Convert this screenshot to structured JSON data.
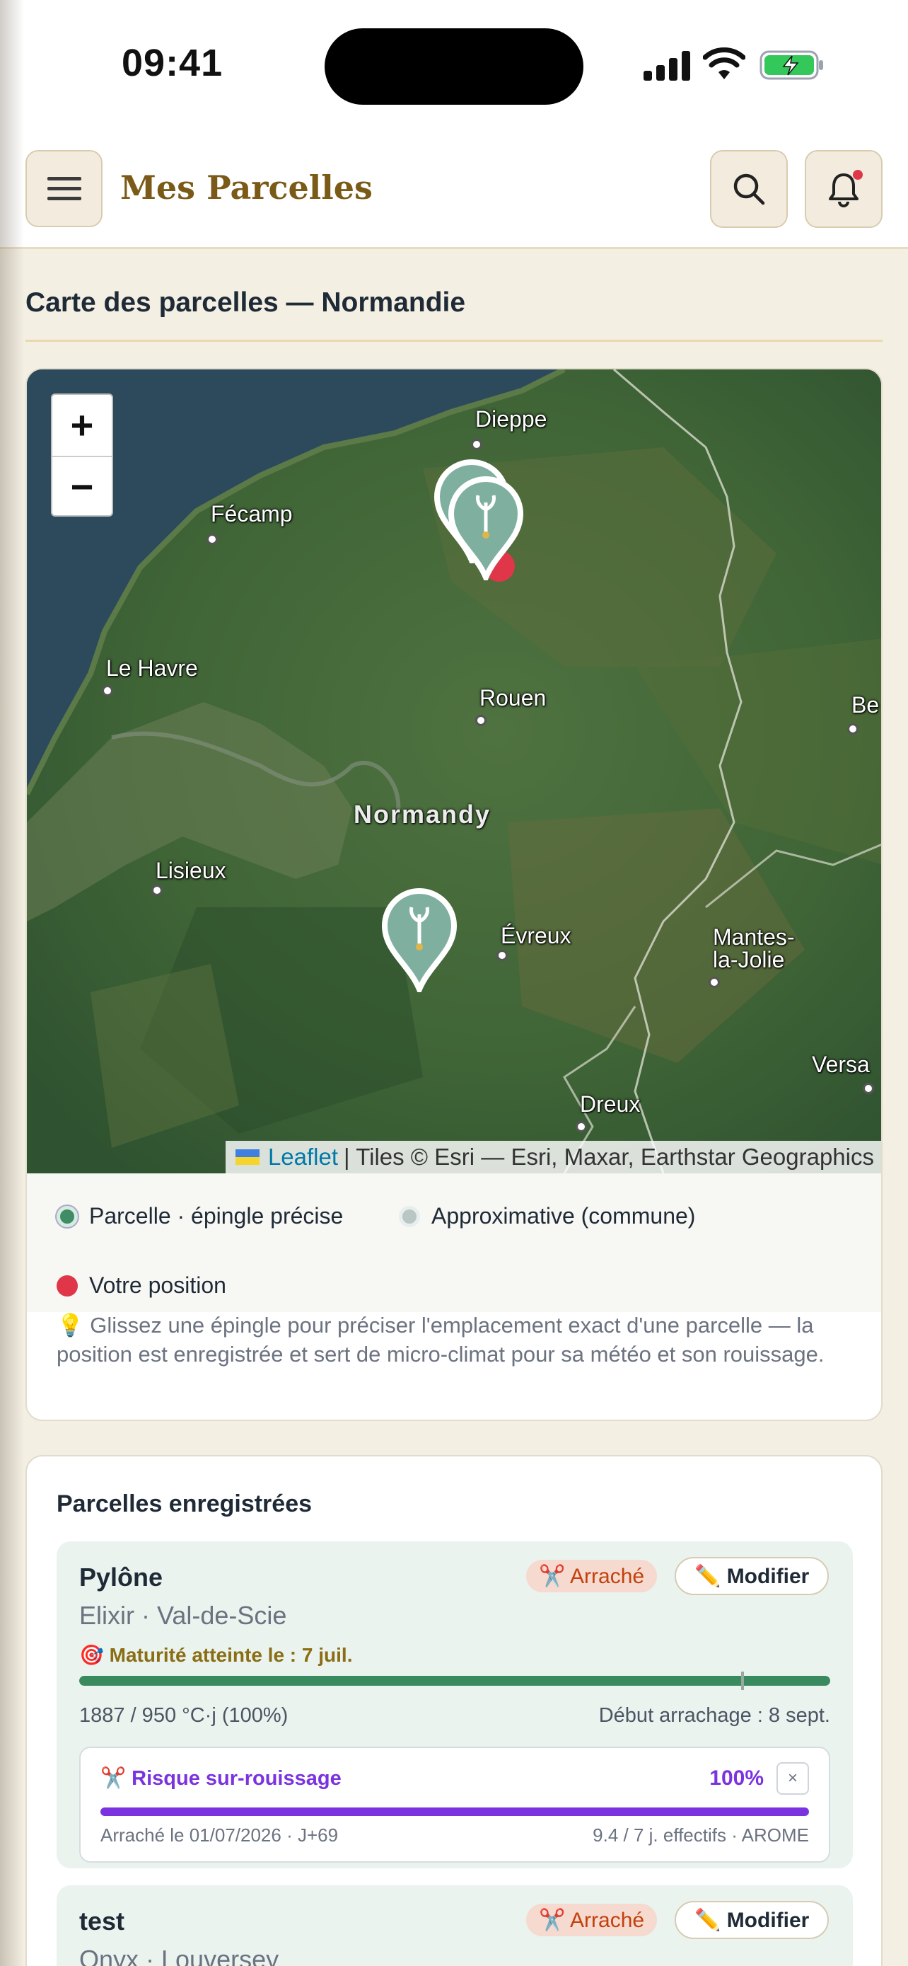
{
  "status": {
    "time": "09:41"
  },
  "header": {
    "title": "Mes Parcelles",
    "menu_icon": "hamburger-icon",
    "search_icon": "search-icon",
    "notifications_icon": "bell-icon"
  },
  "map_section": {
    "title": "Carte des parcelles — Normandie",
    "zoom_in": "+",
    "zoom_out": "−",
    "cities": {
      "dieppe": "Dieppe",
      "fecamp": "Fécamp",
      "le_havre": "Le Havre",
      "rouen": "Rouen",
      "lisieux": "Lisieux",
      "evreux": "Évreux",
      "mantes": "Mantes-la-Jolie",
      "dreux": "Dreux",
      "beauvais": "Be",
      "versailles": "Versa"
    },
    "region": "Normandy",
    "attribution": {
      "leaflet": "Leaflet",
      "tiles": "| Tiles © Esri — Esri, Maxar, Earthstar Geographics"
    },
    "legend": {
      "precise": "Parcelle · épingle précise",
      "approx": "Approximative (commune)",
      "position": "Votre position"
    },
    "hint": "💡 Glissez une épingle pour préciser l'emplacement exact d'une parcelle — la position est enregistrée et sert de micro-climat pour sa météo et son rouissage."
  },
  "parcels": {
    "title": "Parcelles enregistrées",
    "items": [
      {
        "name": "Pylône",
        "variety_place": "Elixir · Val-de-Scie",
        "status": "✂️ Arraché",
        "edit": "✏️ Modifier",
        "maturity": "🎯 Maturité atteinte le : 7 juil.",
        "progress": 1.0,
        "gdd": "1887 / 950 °C·j (100%)",
        "harvest_start": "Début arrachage : 8 sept.",
        "risk": {
          "title": "✂️ Risque sur-rouissage",
          "pct": "100%",
          "close": "×",
          "date": "Arraché le 01/07/2026 · J+69",
          "model": "9.4 / 7 j. effectifs · AROME"
        }
      },
      {
        "name": "test",
        "variety_place": "Onyx · Louversey",
        "status": "✂️ Arraché",
        "edit": "✏️ Modifier"
      }
    ]
  },
  "colors": {
    "accent_brown": "#7a5a16",
    "precise_green": "#3f8c66",
    "position_red": "#e0364a",
    "risk_purple": "#7b33e0"
  }
}
